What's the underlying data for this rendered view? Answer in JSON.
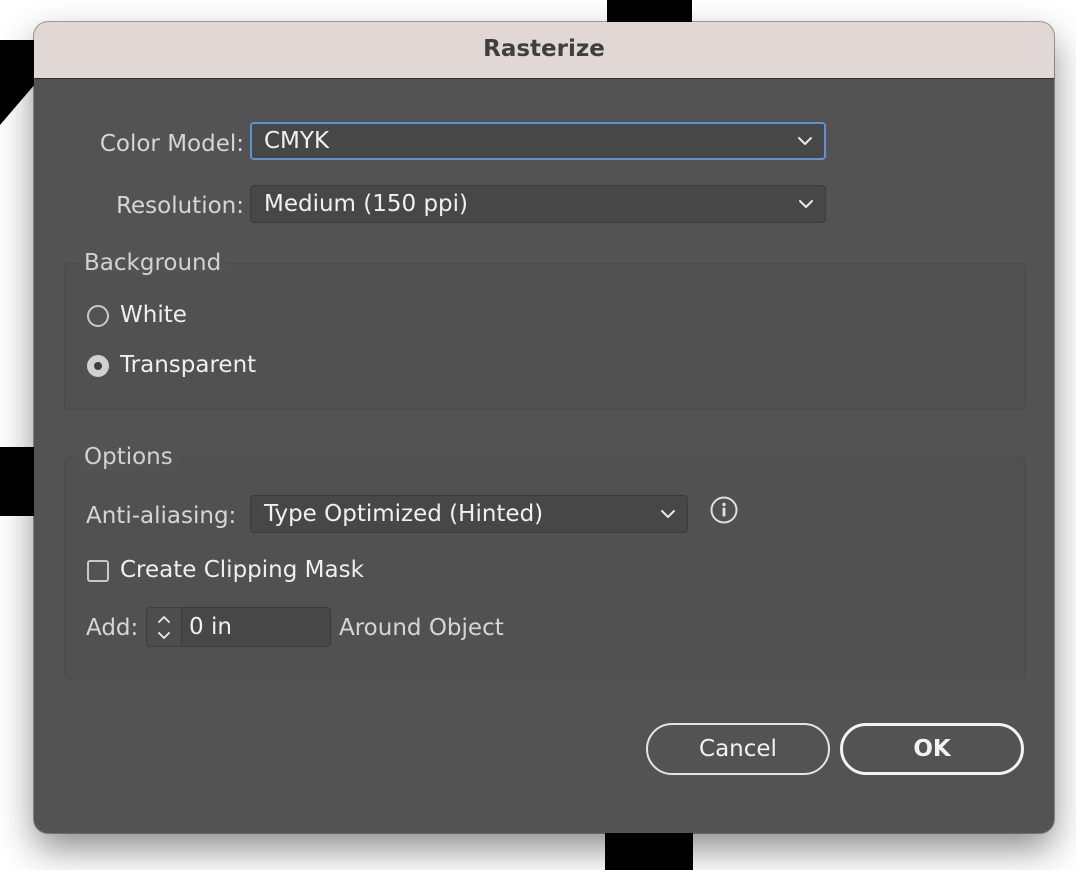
{
  "dialog": {
    "title": "Rasterize"
  },
  "color_model": {
    "label": "Color Model:",
    "value": "CMYK"
  },
  "resolution": {
    "label": "Resolution:",
    "value": "Medium (150 ppi)"
  },
  "background": {
    "title": "Background",
    "options": [
      {
        "label": "White",
        "checked": false
      },
      {
        "label": "Transparent",
        "checked": true
      }
    ]
  },
  "options": {
    "title": "Options",
    "anti_aliasing": {
      "label": "Anti-aliasing:",
      "value": "Type Optimized (Hinted)"
    },
    "clipping_mask": {
      "label": "Create Clipping Mask",
      "checked": false
    },
    "add": {
      "label": "Add:",
      "value": "0 in",
      "suffix": "Around Object"
    }
  },
  "buttons": {
    "cancel": "Cancel",
    "ok": "OK"
  },
  "colors": {
    "dialog_bg": "#535353",
    "titlebar_bg": "#e1d8d6",
    "focus_ring": "#5b93d8"
  }
}
